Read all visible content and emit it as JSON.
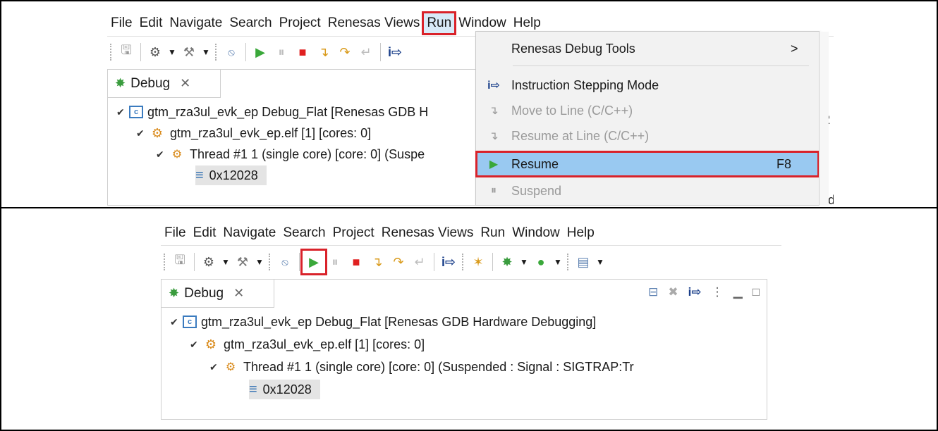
{
  "menu": [
    "File",
    "Edit",
    "Navigate",
    "Search",
    "Project",
    "Renesas Views",
    "Run",
    "Window",
    "Help"
  ],
  "debug_view": {
    "tab_label": "Debug",
    "launch_label": "gtm_rza3ul_evk_ep Debug_Flat [Renesas GDB Hardware Debugging]",
    "launch_label_truncated": "gtm_rza3ul_evk_ep Debug_Flat [Renesas GDB H",
    "process_label": "gtm_rza3ul_evk_ep.elf [1] [cores: 0]",
    "thread_label": "Thread #1 1 (single core) [core: 0] (Suspended : Signal : SIGTRAP:Tr",
    "thread_label_truncated": "Thread #1 1 (single core) [core: 0] (Suspe",
    "frame_label": "0x12028"
  },
  "run_menu": {
    "items": [
      {
        "label": "Renesas Debug Tools",
        "shortcut": "",
        "submenu": true,
        "enabled": true
      },
      {
        "label": "Instruction Stepping Mode",
        "shortcut": "",
        "submenu": false,
        "enabled": true
      },
      {
        "label": "Move to Line (C/C++)",
        "shortcut": "",
        "submenu": false,
        "enabled": false
      },
      {
        "label": "Resume at Line (C/C++)",
        "shortcut": "",
        "submenu": false,
        "enabled": false
      },
      {
        "label": "Resume",
        "shortcut": "F8",
        "submenu": false,
        "enabled": true,
        "selected": true
      },
      {
        "label": "Suspend",
        "shortcut": "",
        "submenu": false,
        "enabled": false
      }
    ],
    "submenu_arrow": ">"
  },
  "background_fragments": {
    "bracket": "]",
    "digit": "2",
    "word_fragment": "ed"
  },
  "icons": {
    "save": "save-icon",
    "debug": "debug-icon",
    "build": "hammer-icon",
    "skip_breakpoints": "skip-breakpoints-icon",
    "resume": "resume-icon",
    "suspend": "suspend-icon",
    "terminate": "terminate-icon",
    "step_into": "step-into-icon",
    "step_over": "step-over-icon",
    "step_return": "step-return-icon",
    "instruction_stepping": "instruction-stepping-icon"
  },
  "colors": {
    "highlight_red": "#d9222a",
    "menu_selection": "#99c9f1",
    "resume_green": "#3aa83a",
    "terminate_red": "#e02020"
  }
}
